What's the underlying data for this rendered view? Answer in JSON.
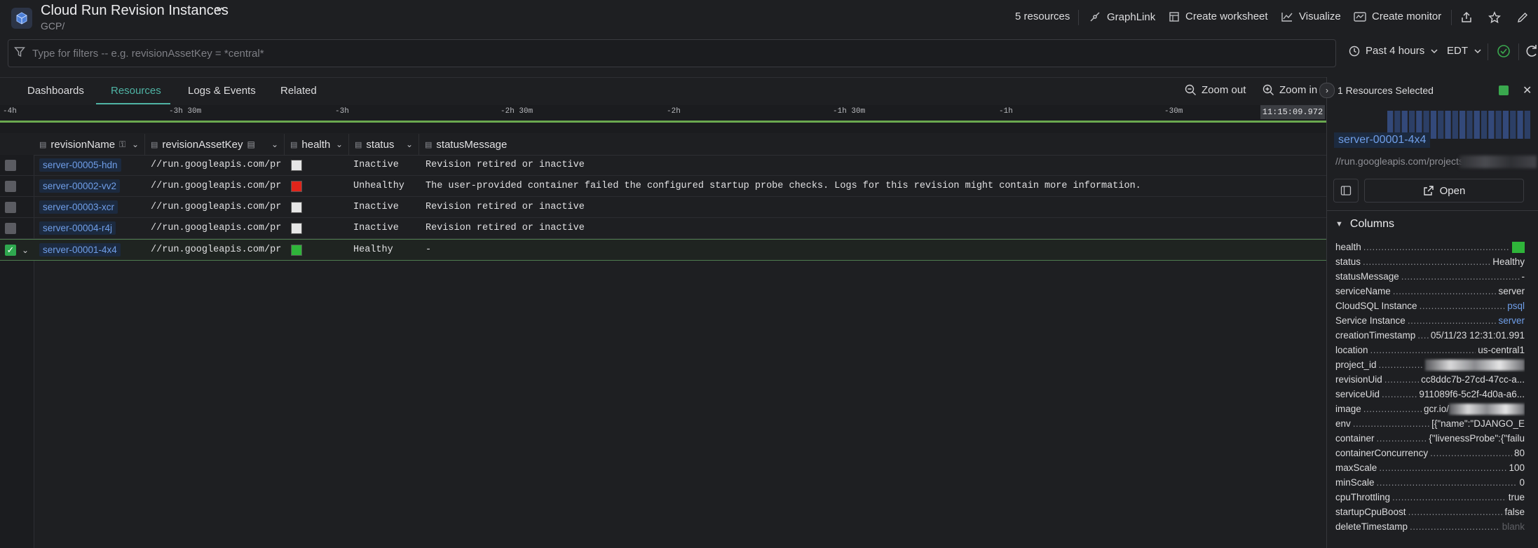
{
  "header": {
    "title": "Cloud Run Revision Instances",
    "subtitle": "GCP/",
    "resources_count": "5 resources",
    "actions": {
      "graphlink": "GraphLink",
      "create_worksheet": "Create worksheet",
      "visualize": "Visualize",
      "create_monitor": "Create monitor"
    }
  },
  "filter": {
    "placeholder": "Type for filters -- e.g. revisionAssetKey = *central*",
    "time_range": "Past 4 hours",
    "timezone": "EDT"
  },
  "tabs": [
    {
      "label": "Dashboards"
    },
    {
      "label": "Resources",
      "active": true
    },
    {
      "label": "Logs & Events"
    },
    {
      "label": "Related"
    }
  ],
  "zoom": {
    "out": "Zoom out",
    "in": "Zoom in"
  },
  "timeline": {
    "ticks": [
      "-4h",
      "-3h 30m",
      "-3h",
      "-2h 30m",
      "-2h",
      "-1h 30m",
      "-1h",
      "-30m"
    ],
    "now": "11:15:09.972"
  },
  "table": {
    "columns": [
      "revisionName",
      "revisionAssetKey",
      "health",
      "status",
      "statusMessage"
    ],
    "rows": [
      {
        "revisionName": "server-00005-hdn",
        "revisionAssetKey": "//run.googleapis.com/pr",
        "health": "#e6e6e6",
        "status": "Inactive",
        "statusMessage": "Revision retired or inactive",
        "selected": false
      },
      {
        "revisionName": "server-00002-vv2",
        "revisionAssetKey": "//run.googleapis.com/pr",
        "health": "#e0251b",
        "status": "Unhealthy",
        "statusMessage": "The user-provided container failed the configured startup probe checks. Logs for this revision might contain more information.",
        "selected": false
      },
      {
        "revisionName": "server-00003-xcr",
        "revisionAssetKey": "//run.googleapis.com/pr",
        "health": "#e6e6e6",
        "status": "Inactive",
        "statusMessage": "Revision retired or inactive",
        "selected": false
      },
      {
        "revisionName": "server-00004-r4j",
        "revisionAssetKey": "//run.googleapis.com/pr",
        "health": "#e6e6e6",
        "status": "Inactive",
        "statusMessage": "Revision retired or inactive",
        "selected": false
      },
      {
        "revisionName": "server-00001-4x4",
        "revisionAssetKey": "//run.googleapis.com/pr",
        "health": "#2fb53a",
        "status": "Healthy",
        "statusMessage": "-",
        "selected": true
      }
    ]
  },
  "panel": {
    "selected_label": "1 Resources Selected",
    "resource_name": "server-00001-4x4",
    "resource_url": "//run.googleapis.com/projects",
    "open_label": "Open",
    "columns_header": "Columns",
    "fields": [
      {
        "key": "health",
        "value": "",
        "type": "swatch"
      },
      {
        "key": "status",
        "value": "Healthy"
      },
      {
        "key": "statusMessage",
        "value": "-"
      },
      {
        "key": "serviceName",
        "value": "server"
      },
      {
        "key": "CloudSQL Instance",
        "value": "psql",
        "type": "link"
      },
      {
        "key": "Service Instance",
        "value": "server",
        "type": "link"
      },
      {
        "key": "creationTimestamp",
        "value": "05/11/23 12:31:01.991"
      },
      {
        "key": "location",
        "value": "us-central1"
      },
      {
        "key": "project_id",
        "value": "",
        "type": "redacted"
      },
      {
        "key": "revisionUid",
        "value": "cc8ddc7b-27cd-47cc-a..."
      },
      {
        "key": "serviceUid",
        "value": "911089f6-5c2f-4d0a-a6..."
      },
      {
        "key": "image",
        "value": "gcr.io/",
        "type": "redacted-suffix"
      },
      {
        "key": "env",
        "value": "[{\"name\":\"DJANGO_E",
        "type": "json"
      },
      {
        "key": "container",
        "value": "{\"livenessProbe\":{\"failu",
        "type": "json"
      },
      {
        "key": "containerConcurrency",
        "value": "80"
      },
      {
        "key": "maxScale",
        "value": "100"
      },
      {
        "key": "minScale",
        "value": "0"
      },
      {
        "key": "cpuThrottling",
        "value": "true"
      },
      {
        "key": "startupCpuBoost",
        "value": "false"
      },
      {
        "key": "deleteTimestamp",
        "value": "blank",
        "type": "muted"
      }
    ]
  },
  "colors": {
    "accent": "#4fb3a4",
    "link": "#6f9ee8",
    "healthy": "#2fb53a",
    "unhealthy": "#e0251b",
    "inactive": "#e6e6e6"
  },
  "icons": [
    "app-cube-icon",
    "chevron-down-icon",
    "graphlink-icon",
    "worksheet-icon",
    "visualize-icon",
    "monitor-icon",
    "share-icon",
    "star-icon",
    "edit-icon",
    "filter-icon",
    "clock-icon",
    "check-circle-icon",
    "refresh-icon",
    "zoom-out-icon",
    "zoom-in-icon",
    "close-icon",
    "external-link-icon",
    "panel-icon",
    "caret-down-icon"
  ]
}
